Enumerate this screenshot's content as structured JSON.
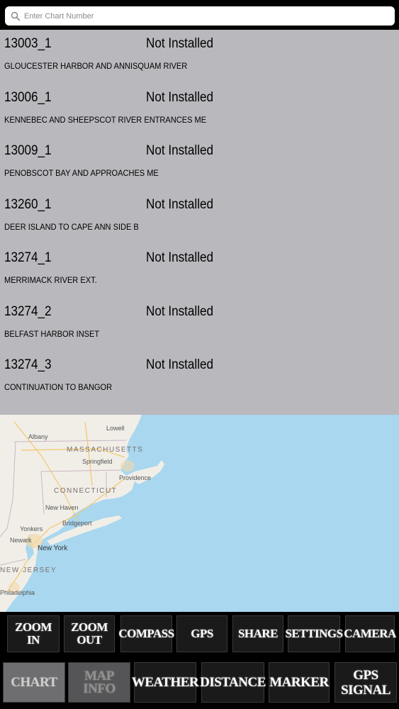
{
  "search": {
    "placeholder": "Enter Chart Number"
  },
  "charts": [
    {
      "number": "13003_1",
      "status": "Not Installed",
      "name": "GLOUCESTER HARBOR AND ANNISQUAM RIVER"
    },
    {
      "number": "13006_1",
      "status": "Not Installed",
      "name": "KENNEBEC AND SHEEPSCOT RIVER ENTRANCES  ME"
    },
    {
      "number": "13009_1",
      "status": "Not Installed",
      "name": "PENOBSCOT BAY AND APPROACHES  ME"
    },
    {
      "number": "13260_1",
      "status": "Not Installed",
      "name": "DEER ISLAND TO CAPE ANN  SIDE B"
    },
    {
      "number": "13274_1",
      "status": "Not Installed",
      "name": "MERRIMACK RIVER EXT."
    },
    {
      "number": "13274_2",
      "status": "Not Installed",
      "name": "BELFAST HARBOR  INSET"
    },
    {
      "number": "13274_3",
      "status": "Not Installed",
      "name": "CONTINUATION TO BANGOR"
    }
  ],
  "map": {
    "states": [
      "MASSACHUSETTS",
      "CONNECTICUT",
      "NEW JERSEY"
    ],
    "cities": [
      "Lowell",
      "Albany",
      "Springfield",
      "Providence",
      "New Haven",
      "Bridgeport",
      "Yonkers",
      "Newark",
      "New York",
      "Philadelphia"
    ]
  },
  "toolbar": {
    "zoom_in": "ZOOM IN",
    "zoom_out": "ZOOM OUT",
    "compass": "COMPASS",
    "gps": "GPS",
    "share": "SHARE",
    "settings": "SETTINGS",
    "camera": "CAMERA",
    "chart": "CHART",
    "map_info": "MAP INFO",
    "weather": "WEATHER",
    "distance": "DISTANCE",
    "marker": "MARKER",
    "gps_signal_1": "GPS",
    "gps_signal_2": "SIGNAL"
  }
}
